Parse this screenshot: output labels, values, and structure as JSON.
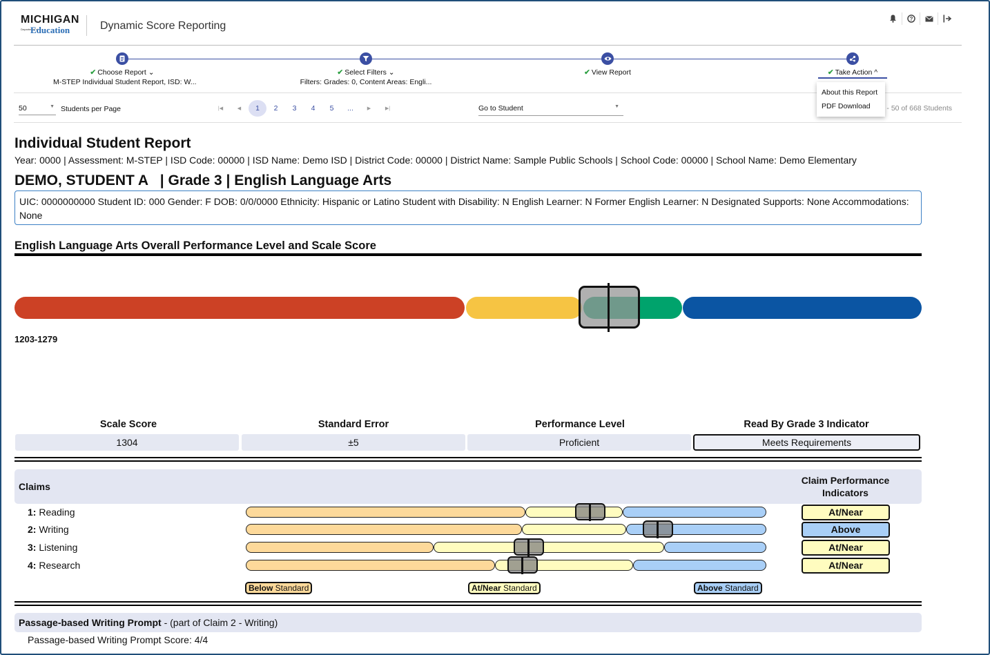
{
  "header": {
    "logo_state": "MICHIGAN",
    "logo_dept": "Department of",
    "logo_edu": "Education",
    "app_title": "Dynamic Score Reporting",
    "icons": [
      "bell-icon",
      "help-icon",
      "mail-icon",
      "logout-icon"
    ]
  },
  "stepper": {
    "steps": [
      {
        "label": "Choose Report",
        "sub": "M-STEP Individual Student Report, ISD: W...",
        "icon": "document-icon"
      },
      {
        "label": "Select Filters",
        "sub": "Filters: Grades: 0, Content Areas: Engli...",
        "icon": "filter-icon"
      },
      {
        "label": "View Report",
        "sub": "",
        "icon": "eye-icon"
      },
      {
        "label": "Take Action",
        "sub": "",
        "icon": "share-icon"
      }
    ],
    "check": "✔",
    "chevron_down": "⌄",
    "chevron_up": "^"
  },
  "toolbar": {
    "per_page": "50",
    "per_page_label": "Students per Page",
    "pages": [
      "1",
      "2",
      "3",
      "4",
      "5",
      "..."
    ],
    "current_page": "1",
    "goto_label": "Go to Student",
    "count": "- 50 of 668 Students"
  },
  "menu": {
    "items": [
      "About this Report",
      "PDF Download"
    ]
  },
  "report": {
    "title": "Individual Student Report",
    "meta": "Year: 0000 | Assessment: M-STEP | ISD Code: 00000 | ISD Name: Demo ISD | District Code: 00000 | District Name: Sample Public Schools | School Code: 00000 | School Name:  Demo Elementary",
    "student": "DEMO, STUDENT A   | Grade 3 | English Language Arts",
    "demographics": "UIC: 0000000000  Student ID: 000  Gender: F  DOB: 0/0/0000  Ethnicity: Hispanic or Latino  Student with Disability: N  English Learner: N  Former English Learner: N  Designated Supports: None  Accommodations: None",
    "overall_title": "English Language Arts Overall Performance Level and Scale Score",
    "range_label": "1203-1279",
    "performance_colors": [
      "#cc4125",
      "#f6c443",
      "#00a36c",
      "#0b55a3"
    ],
    "score_headers": [
      "Scale Score",
      "Standard Error",
      "Performance Level",
      "Read By Grade 3 Indicator"
    ],
    "score_values": [
      "1304",
      "±5",
      "Proficient",
      "Meets Requirements"
    ]
  },
  "claims": {
    "header": "Claims",
    "indicator_header": "Claim Performance Indicators",
    "colors": {
      "below": "#fdd99a",
      "near": "#fffcbf",
      "above": "#a9cff7"
    },
    "rows": [
      {
        "num": "1:",
        "name": " Reading",
        "indicator": "At/Near",
        "level": "near"
      },
      {
        "num": "2:",
        "name": " Writing",
        "indicator": "Above",
        "level": "above"
      },
      {
        "num": "3:",
        "name": " Listening",
        "indicator": "At/Near",
        "level": "near"
      },
      {
        "num": "4:",
        "name": " Research",
        "indicator": "At/Near",
        "level": "near"
      }
    ],
    "legend": [
      {
        "bold": "Below",
        "rest": " Standard"
      },
      {
        "bold": "At/Near",
        "rest": " Standard"
      },
      {
        "bold": "Above",
        "rest": " Standard"
      }
    ]
  },
  "writing": {
    "header_bold": "Passage-based Writing Prompt",
    "header_rest": " - (part of Claim 2 - Writing)",
    "score_line": "Passage-based Writing Prompt Score: 4/4"
  }
}
